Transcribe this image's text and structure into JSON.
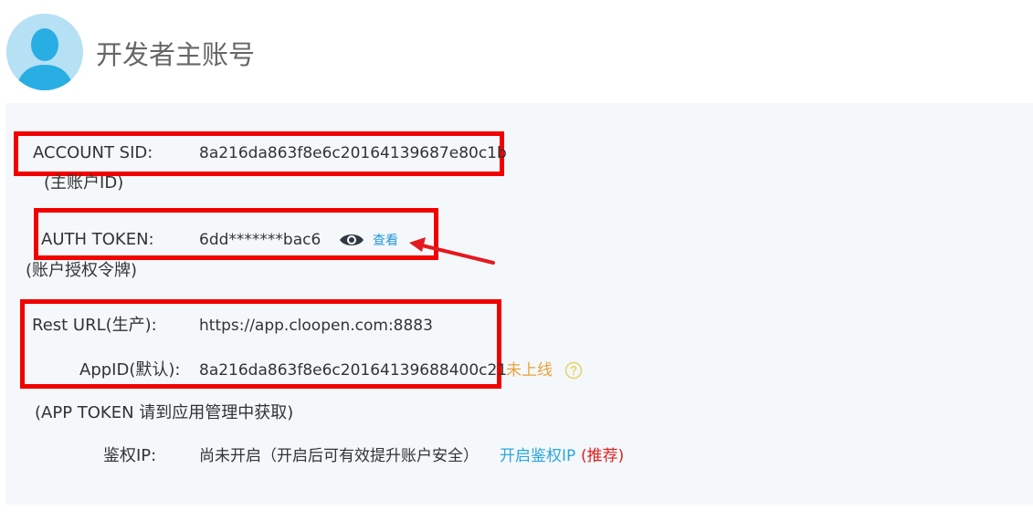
{
  "header": {
    "title": "开发者主账号"
  },
  "account": {
    "sid_label": "ACCOUNT SID:",
    "sid_value": "8a216da863f8e6c20164139687e80c1b",
    "sid_note": "(主账户ID)",
    "token_label": "AUTH TOKEN:",
    "token_value": "6dd*******bac6",
    "token_view": "查看",
    "token_note": "(账户授权令牌)",
    "resturl_label": "Rest URL(生产):",
    "resturl_value": "https://app.cloopen.com:8883",
    "appid_label": "AppID(默认):",
    "appid_value": "8a216da863f8e6c20164139688400c21",
    "appid_status": "未上线",
    "apptoken_note": "(APP TOKEN 请到应用管理中获取)",
    "authip_label": "鉴权IP:",
    "authip_value": "尚未开启（开启后可有效提升账户安全）",
    "authip_link": "开启鉴权IP",
    "authip_recommend": "(推荐)"
  },
  "colors": {
    "highlight_box": "#f20000",
    "link": "#2396d8",
    "status_orange": "#e8a23a",
    "recommend_red": "#e02020",
    "panel_bg": "#f4f8fb"
  },
  "icons": {
    "avatar": "user-avatar-icon",
    "view": "eye-icon",
    "help": "question-circle-icon",
    "annotation": "arrow-annotation"
  }
}
